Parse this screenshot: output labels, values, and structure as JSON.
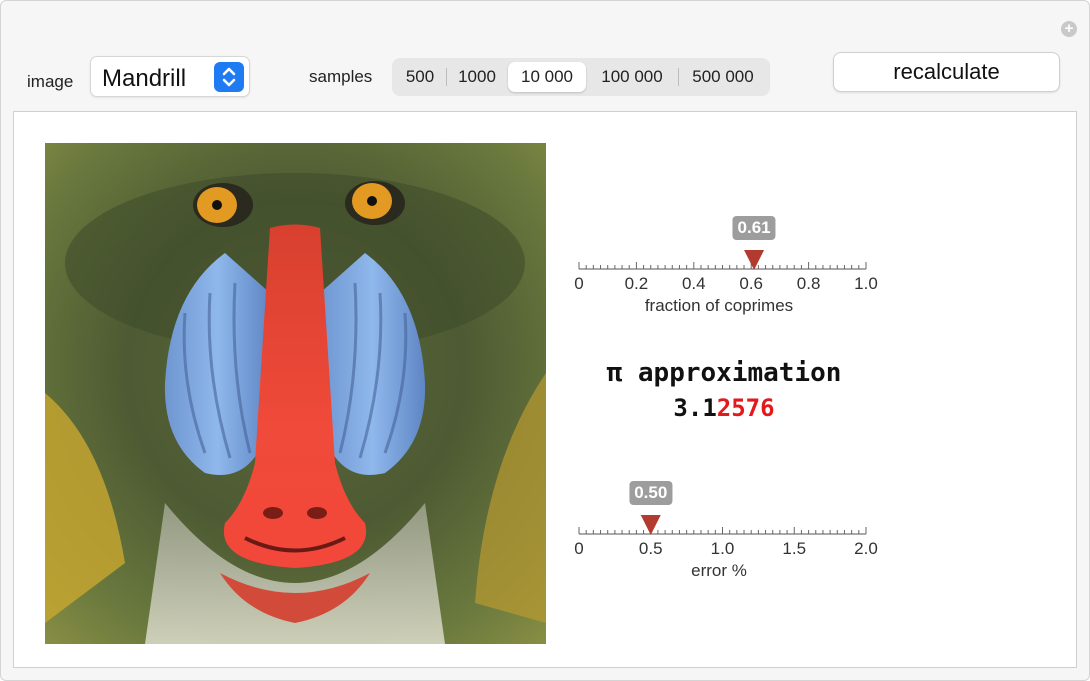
{
  "controls": {
    "image_label": "image",
    "image_value": "Mandrill",
    "samples_label": "samples",
    "samples_options": [
      "500",
      "1000",
      "10 000",
      "100 000",
      "500 000"
    ],
    "samples_selected": 2,
    "recalculate_label": "recalculate"
  },
  "result": {
    "title": "π approximation",
    "value_correct": "3.1",
    "value_wrong": "2576",
    "colors": {
      "correct": "#111111",
      "wrong": "#e3191b"
    }
  },
  "gauges": [
    {
      "name": "fraction-of-coprimes",
      "label": "fraction of coprimes",
      "value": 0.61,
      "value_text": "0.61",
      "min": 0,
      "max": 1.0,
      "ticks": [
        "0",
        "0.2",
        "0.4",
        "0.6",
        "0.8",
        "1.0"
      ],
      "pointer_color": "#b23a2e"
    },
    {
      "name": "error-percent",
      "label": "error %",
      "value": 0.5,
      "value_text": "0.50",
      "min": 0,
      "max": 2.0,
      "ticks": [
        "0",
        "0.5",
        "1.0",
        "1.5",
        "2.0"
      ],
      "pointer_color": "#b23a2e"
    }
  ]
}
